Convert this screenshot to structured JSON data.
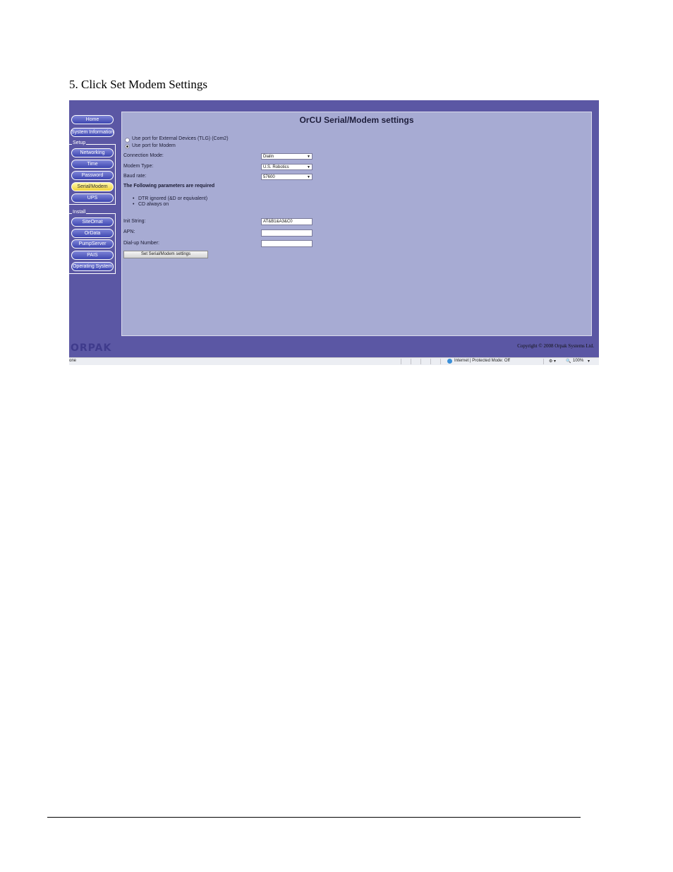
{
  "instruction": "5.   Click Set Modem Settings",
  "nav": {
    "home": "Home",
    "system_information": "System Information",
    "setup_label": "Setup",
    "setup_items": [
      "Networking",
      "Time",
      "Password",
      "Serial/Modem",
      "UPS"
    ],
    "install_label": "Install",
    "install_items": [
      "SiteOmat",
      "OrData",
      "PumpServer",
      "PAIS",
      "Operating System"
    ],
    "active_item": "Serial/Modem"
  },
  "panel": {
    "title": "OrCU Serial/Modem settings",
    "radio_external": "Use port for External Devices (TLG) (Com2)",
    "radio_modem": "Use port for Modem",
    "connection_mode_label": "Connection Mode:",
    "connection_mode_value": "Dialin",
    "modem_type_label": "Modem Type:",
    "modem_type_value": "U.S. Robotics",
    "baud_rate_label": "Baud rate:",
    "baud_rate_value": "57600",
    "required_heading": "The Following parameters are required",
    "requirements": [
      "DTR ignored (&D or equivalent)",
      "CD always on"
    ],
    "init_string_label": "Init String:",
    "init_string_value": "AT&B1&A3&C0",
    "apn_label": "APN:",
    "apn_value": "",
    "dialup_label": "Dial-up Number:",
    "dialup_value": "",
    "submit_label": "Set Serial/Modem settings"
  },
  "footer": {
    "logo": "ORPAK",
    "copyright": "Copyright © 2008 Orpak Systems Ltd."
  },
  "statusbar": {
    "left": "one",
    "zone": "Internet | Protected Mode: Off",
    "zoom": "100%"
  }
}
